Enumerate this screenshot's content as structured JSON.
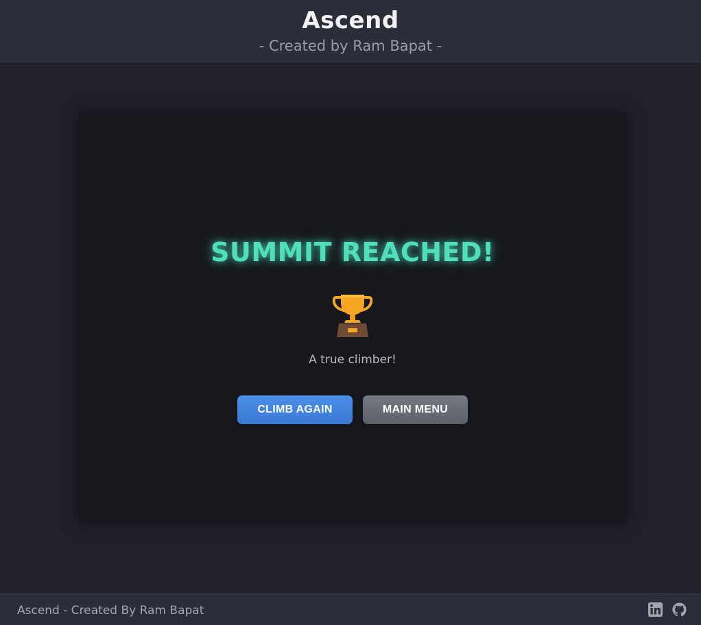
{
  "header": {
    "title": "Ascend",
    "subtitle": "- Created by Ram Bapat -"
  },
  "game": {
    "result_title": "SUMMIT REACHED!",
    "result_icon": "trophy-icon",
    "result_message": "A true climber!",
    "buttons": {
      "climb_again": "CLIMB AGAIN",
      "main_menu": "MAIN MENU"
    }
  },
  "footer": {
    "text": "Ascend - Created By Ram Bapat",
    "social_icons": [
      "linkedin-icon",
      "github-icon"
    ]
  },
  "colors": {
    "accent": "#4fe0bb",
    "primary_button": "#3a78d4",
    "secondary_button": "#5b5f67",
    "background": "#20212a",
    "stage": "#17181d"
  }
}
